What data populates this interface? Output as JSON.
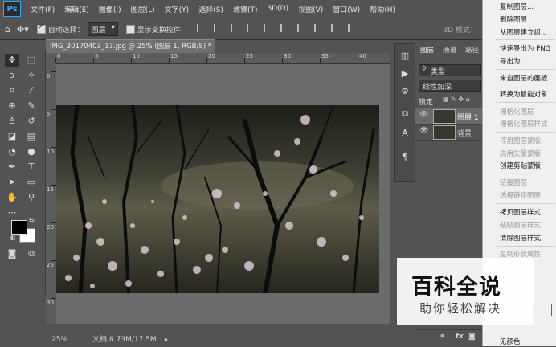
{
  "app": {
    "logo": "Ps",
    "menu": [
      "文件(F)",
      "编辑(E)",
      "图像(I)",
      "图层(L)",
      "文字(Y)",
      "选择(S)",
      "滤镜(T)",
      "3D(D)",
      "视图(V)",
      "窗口(W)",
      "帮助(H)"
    ]
  },
  "options_bar": {
    "auto_select_label": "自动选择：",
    "auto_select_value": "图层",
    "show_transform_label": "显示变换控件",
    "mode3d_label": "3D 模式："
  },
  "document": {
    "tab_title": "IMG_20170403_13.jpg @ 25% (图层 1, RGB/8) *",
    "close_glyph": "×",
    "ruler_top_labels": [
      "0",
      "5",
      "10",
      "15",
      "20",
      "25",
      "30",
      "35",
      "40"
    ],
    "ruler_left_labels": [
      "0",
      "5",
      "10",
      "15",
      "20",
      "25",
      "30"
    ]
  },
  "status": {
    "zoom": "25%",
    "doc_info": "文档:8.73M/17.5M"
  },
  "layers_panel": {
    "tabs": [
      "图层",
      "通道",
      "路径"
    ],
    "filter_kind": "类型",
    "blend_mode": "线性加深",
    "lock_label": "锁定：",
    "layers": [
      {
        "name": "图层 1",
        "selected": true
      },
      {
        "name": "背景",
        "selected": false
      }
    ],
    "footer_icons": [
      "link-icon",
      "fx-icon",
      "mask-icon"
    ],
    "footer_fx": "fx"
  },
  "context_menu": {
    "items": [
      {
        "label": "复制图层...",
        "enabled": true
      },
      {
        "label": "删除图层",
        "enabled": true
      },
      {
        "label": "从图层建立组...",
        "enabled": true
      },
      {
        "label": "快速导出为 PNG",
        "enabled": true
      },
      {
        "label": "导出为...",
        "enabled": true
      },
      {
        "label": "来自图层的画板...",
        "enabled": true
      },
      {
        "label": "转换为智能对象",
        "enabled": true
      },
      {
        "label": "栅格化图层",
        "enabled": false
      },
      {
        "label": "栅格化图层样式",
        "enabled": false
      },
      {
        "label": "停用图层蒙版",
        "enabled": false
      },
      {
        "label": "启用矢量蒙版",
        "enabled": false
      },
      {
        "label": "创建剪贴蒙版",
        "enabled": true
      },
      {
        "label": "链接图层",
        "enabled": false
      },
      {
        "label": "选择链接图层",
        "enabled": false
      },
      {
        "label": "拷贝图层样式",
        "enabled": true
      },
      {
        "label": "粘贴图层样式",
        "enabled": false
      },
      {
        "label": "清除图层样式",
        "enabled": true
      },
      {
        "label": "复制形状属性",
        "enabled": false
      },
      {
        "label": "无颜色",
        "enabled": true
      }
    ]
  },
  "watermark": {
    "title": "百科全说",
    "subtitle": "助你轻松解决"
  },
  "colors": {
    "ui_bg": "#535353",
    "canvas_bg": "#6b6b6b",
    "accent": "#31a8ff"
  }
}
